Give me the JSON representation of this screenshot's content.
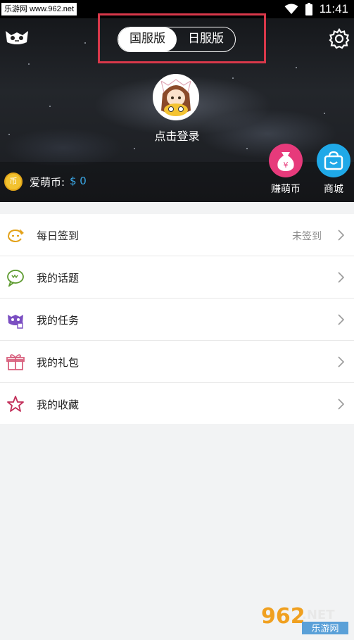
{
  "status_bar": {
    "watermark": "乐游网 www.962.net",
    "time": "11:41"
  },
  "header": {
    "version_toggle": {
      "options": [
        "国服版",
        "日服版"
      ],
      "selected": "国服版"
    },
    "login_text": "点击登录",
    "coins": {
      "label": "爱萌币:",
      "value": "$ 0",
      "icon_glyph": "币"
    },
    "actions": [
      {
        "label": "赚萌币",
        "icon": "money-bag-icon",
        "color": "#e73a7b",
        "glyph": "¥"
      },
      {
        "label": "商城",
        "icon": "shopping-bag-icon",
        "color": "#1fa9e8"
      }
    ]
  },
  "menu": [
    {
      "label": "每日签到",
      "status": "未签到",
      "icon": "checkin-icon",
      "color": "#e3a21a"
    },
    {
      "label": "我的话题",
      "status": "",
      "icon": "chat-bubble-icon",
      "color": "#5c9a2e"
    },
    {
      "label": "我的任务",
      "status": "",
      "icon": "task-cat-icon",
      "color": "#7b4fc2"
    },
    {
      "label": "我的礼包",
      "status": "",
      "icon": "gift-icon",
      "color": "#d8607e"
    },
    {
      "label": "我的收藏",
      "status": "",
      "icon": "star-icon",
      "color": "#c22f5a"
    }
  ],
  "watermark_br": {
    "brand": "962",
    "suffix": ".NET",
    "tagline": "乐游网"
  },
  "colors": {
    "highlight_box": "#d8384a",
    "coin_value": "#3aa7e6"
  }
}
